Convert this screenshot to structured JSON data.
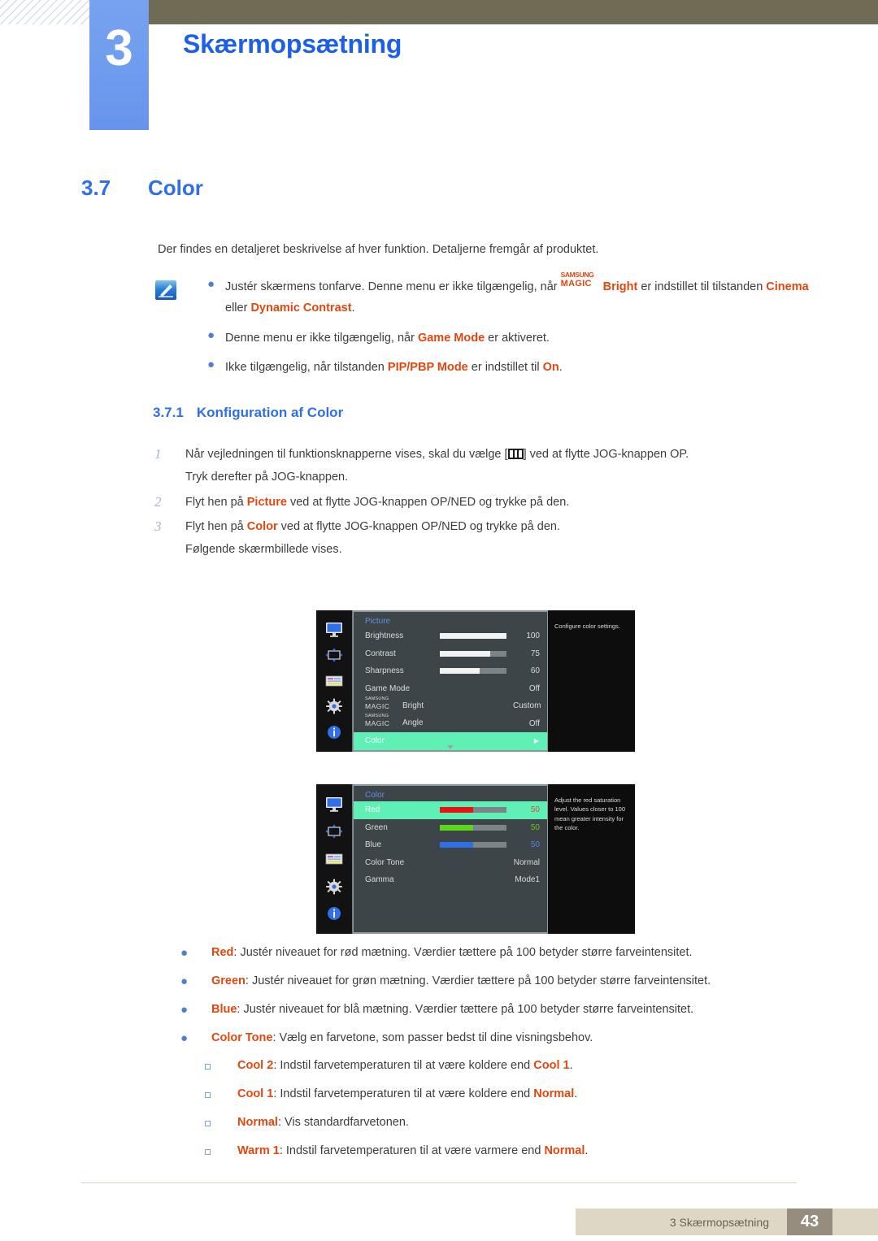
{
  "header": {
    "chapter_number": "3",
    "chapter_title": "Skærmopsætning"
  },
  "section": {
    "number": "3.7",
    "title": "Color"
  },
  "intro_paragraph": "Der findes en detaljeret beskrivelse af hver funktion. Detaljerne fremgår af produktet.",
  "note": {
    "icon": "note-pen-icon",
    "bullets": [
      {
        "parts": [
          {
            "t": "Justér skærmens tonfarve. Denne menu er ikke tilgængelig, når ",
            "hl": false
          },
          {
            "t": "MAGIC_BRIGHT",
            "hl": "magic"
          },
          {
            "t": " er indstillet til tilstanden ",
            "hl": false
          },
          {
            "t": "Cinema",
            "hl": true
          },
          {
            "t": " eller ",
            "hl": false
          },
          {
            "t": "Dynamic Contrast",
            "hl": true
          },
          {
            "t": ".",
            "hl": false
          }
        ]
      },
      {
        "parts": [
          {
            "t": "Denne menu er ikke tilgængelig, når ",
            "hl": false
          },
          {
            "t": "Game Mode",
            "hl": true
          },
          {
            "t": " er aktiveret.",
            "hl": false
          }
        ]
      },
      {
        "parts": [
          {
            "t": "Ikke tilgængelig, når tilstanden ",
            "hl": false
          },
          {
            "t": "PIP/PBP Mode",
            "hl": true
          },
          {
            "t": " er indstillet til ",
            "hl": false
          },
          {
            "t": "On",
            "hl": true
          },
          {
            "t": ".",
            "hl": false
          }
        ]
      }
    ],
    "magic_super": "SAMSUNG",
    "magic_main": "MAGIC",
    "magic_suffix": "Bright"
  },
  "subsection": {
    "number": "3.7.1",
    "title": "Konfiguration af Color"
  },
  "steps": [
    {
      "num": "1",
      "parts": [
        {
          "t": "Når vejledningen til funktionsknapperne vises, skal du vælge [",
          "hl": false
        },
        {
          "t": "KEY_ICON",
          "hl": "key"
        },
        {
          "t": "] ved at flytte JOG-knappen OP.",
          "hl": false
        }
      ],
      "line2": "Tryk derefter på JOG-knappen."
    },
    {
      "num": "2",
      "parts": [
        {
          "t": "Flyt hen på ",
          "hl": false
        },
        {
          "t": "Picture",
          "hl": true
        },
        {
          "t": " ved at flytte JOG-knappen OP/NED og trykke på den.",
          "hl": false
        }
      ],
      "line2": ""
    },
    {
      "num": "3",
      "parts": [
        {
          "t": "Flyt hen på ",
          "hl": false
        },
        {
          "t": "Color",
          "hl": true
        },
        {
          "t": " ved at flytte JOG-knappen OP/NED og trykke på den.",
          "hl": false
        }
      ],
      "line2": "Følgende skærmbillede vises."
    }
  ],
  "osd_picture": {
    "title": "Picture",
    "rail_icons": [
      "monitor-icon",
      "move-arrows-icon",
      "list-icon",
      "gear-icon",
      "info-icon"
    ],
    "help_text": "Configure color settings.",
    "rows": [
      {
        "label": "Brightness",
        "type": "slider",
        "fill_pct": 100,
        "fill_color": "#f2f2f2",
        "value": "100",
        "highlight": false
      },
      {
        "label": "Contrast",
        "type": "slider",
        "fill_pct": 75,
        "fill_color": "#f2f2f2",
        "value": "75",
        "highlight": false
      },
      {
        "label": "Sharpness",
        "type": "slider",
        "fill_pct": 60,
        "fill_color": "#f2f2f2",
        "value": "60",
        "highlight": false
      },
      {
        "label": "Game Mode",
        "type": "value",
        "value": "Off",
        "highlight": false
      },
      {
        "label": "MAGIC_Bright",
        "type": "magic",
        "magic_suffix": "Bright",
        "value": "Custom",
        "highlight": false
      },
      {
        "label": "MAGIC_Angle",
        "type": "magic",
        "magic_suffix": "Angle",
        "value": "Off",
        "highlight": false
      },
      {
        "label": "Color",
        "type": "submenu",
        "value": "",
        "highlight": true
      }
    ],
    "magic_super": "SAMSUNG",
    "magic_main": "MAGIC"
  },
  "osd_color": {
    "title": "Color",
    "rail_icons": [
      "monitor-icon",
      "move-arrows-icon",
      "list-icon",
      "gear-icon",
      "info-icon"
    ],
    "help_text": "Adjust the red saturation level. Values closer to 100 mean greater intensity for the color.",
    "rows": [
      {
        "label": "Red",
        "type": "slider",
        "fill_pct": 50,
        "fill_color": "#ee1111",
        "value": "50",
        "value_color": "#e04a2a",
        "highlight": true
      },
      {
        "label": "Green",
        "type": "slider",
        "fill_pct": 50,
        "fill_color": "#5ed61b",
        "value": "50",
        "value_color": "#73c42a",
        "highlight": false
      },
      {
        "label": "Blue",
        "type": "slider",
        "fill_pct": 50,
        "fill_color": "#2f6fe8",
        "value": "50",
        "value_color": "#4a86e8",
        "highlight": false
      },
      {
        "label": "Color Tone",
        "type": "value",
        "value": "Normal",
        "highlight": false
      },
      {
        "label": "Gamma",
        "type": "value",
        "value": "Mode1",
        "highlight": false
      }
    ]
  },
  "descriptions": [
    {
      "parts": [
        {
          "t": "Red",
          "hl": true
        },
        {
          "t": ": Justér niveauet for rød mætning. Værdier tættere på 100 betyder større farveintensitet.",
          "hl": false
        }
      ]
    },
    {
      "parts": [
        {
          "t": "Green",
          "hl": true
        },
        {
          "t": ": Justér niveauet for grøn mætning. Værdier tættere på 100 betyder større farveintensitet.",
          "hl": false
        }
      ]
    },
    {
      "parts": [
        {
          "t": "Blue",
          "hl": true
        },
        {
          "t": ": Justér niveauet for blå mætning. Værdier tættere på 100 betyder større farveintensitet.",
          "hl": false
        }
      ]
    },
    {
      "parts": [
        {
          "t": "Color Tone",
          "hl": true
        },
        {
          "t": ": Vælg en farvetone, som passer bedst til dine visningsbehov.",
          "hl": false
        }
      ]
    }
  ],
  "color_tone_options": [
    {
      "parts": [
        {
          "t": "Cool 2",
          "hl": true
        },
        {
          "t": ": Indstil farvetemperaturen til at være koldere end ",
          "hl": false
        },
        {
          "t": "Cool 1",
          "hl": true
        },
        {
          "t": ".",
          "hl": false
        }
      ]
    },
    {
      "parts": [
        {
          "t": "Cool 1",
          "hl": true
        },
        {
          "t": ": Indstil farvetemperaturen til at være koldere end ",
          "hl": false
        },
        {
          "t": "Normal",
          "hl": true
        },
        {
          "t": ".",
          "hl": false
        }
      ]
    },
    {
      "parts": [
        {
          "t": "Normal",
          "hl": true
        },
        {
          "t": ": Vis standardfarvetonen.",
          "hl": false
        }
      ]
    },
    {
      "parts": [
        {
          "t": "Warm 1",
          "hl": true
        },
        {
          "t": ": Indstil farvetemperaturen til at være varmere end ",
          "hl": false
        },
        {
          "t": "Normal",
          "hl": true
        },
        {
          "t": ".",
          "hl": false
        }
      ]
    }
  ],
  "footer": {
    "text": "3 Skærmopsætning",
    "page": "43"
  },
  "colors": {
    "brand_blue": "#2f6fe8",
    "accent_orange": "#e2470f",
    "chapter_bar": "#6f6b55",
    "tab_blue": "#6e9bee",
    "osd_highlight": "#5ef0b5",
    "footer_bar": "#ded7c6",
    "footer_page": "#968d7e"
  }
}
